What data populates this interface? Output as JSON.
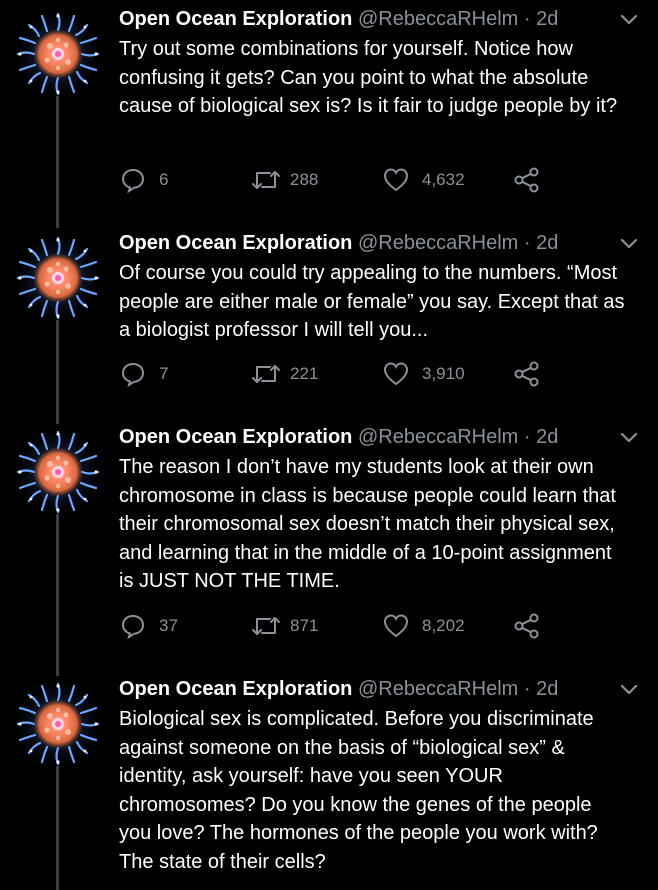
{
  "account": {
    "name": "Open Ocean Exploration",
    "handle": "@RebeccaRHelm",
    "separator": "·",
    "time": "2d"
  },
  "colors": {
    "background": "#000000",
    "text": "#ffffff",
    "muted": "#8a9198",
    "thread_line": "#3a3f45"
  },
  "tweets": [
    {
      "text": "Try out some combinations for yourself. Notice how confusing it gets? Can you point to what the absolute cause of biological sex is? Is it fair to judge people by it?",
      "replies": "6",
      "retweets": "288",
      "likes": "4,632"
    },
    {
      "text": "Of course you could try appealing to the numbers. “Most people are either male or female” you say. Except that as a biologist professor I will tell you...",
      "replies": "7",
      "retweets": "221",
      "likes": "3,910"
    },
    {
      "text": "The reason I don’t have my students look at their own chromosome in class is because people could learn that their chromosomal sex doesn’t match their physical sex, and learning that in the middle of a 10-point assignment is JUST NOT THE TIME.",
      "replies": "37",
      "retweets": "871",
      "likes": "8,202"
    },
    {
      "text": "Biological sex is complicated. Before you discriminate against someone on the basis of “biological sex” & identity, ask yourself: have you seen YOUR chromosomes? Do you know the genes of the people you love? The hormones of the people you work with? The state of their cells?"
    }
  ],
  "icons": {
    "avatar": "siphonophore-avatar-icon",
    "reply": "reply-icon",
    "retweet": "retweet-icon",
    "like": "heart-icon",
    "share": "share-icon",
    "menu": "chevron-down-icon"
  }
}
